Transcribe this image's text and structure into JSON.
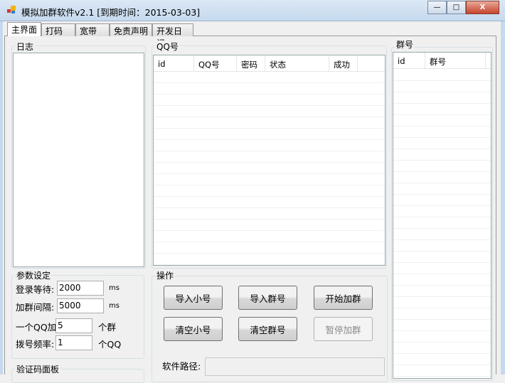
{
  "window": {
    "title": "模拟加群软件v2.1 [到期时间：2015-03-03]",
    "minimize": "—",
    "maximize": "□",
    "close": "X"
  },
  "tabs": [
    "主界面",
    "打码",
    "宽带",
    "免责声明",
    "开发日记"
  ],
  "log": {
    "label": "日志"
  },
  "qq": {
    "label": "QQ号",
    "columns": [
      "id",
      "QQ号",
      "密码",
      "状态",
      "成功"
    ]
  },
  "groups": {
    "label": "群号",
    "columns": [
      "id",
      "群号"
    ]
  },
  "params": {
    "label": "参数设定",
    "login_wait": {
      "label": "登录等待:",
      "value": "2000",
      "unit": "ms"
    },
    "join_interval": {
      "label": "加群间隔:",
      "value": "5000",
      "unit": "ms"
    },
    "per_qq": {
      "label": "一个QQ加:",
      "value": "5",
      "unit": "个群"
    },
    "dial_freq": {
      "label": "拨号频率:",
      "value": "1",
      "unit": "个QQ"
    }
  },
  "captcha": {
    "label": "验证码面板"
  },
  "ops": {
    "label": "操作",
    "import_qq": "导入小号",
    "import_group": "导入群号",
    "start": "开始加群",
    "clear_qq": "清空小号",
    "clear_group": "清空群号",
    "pause": "暂停加群",
    "path_label": "软件路径:",
    "path_value": ""
  }
}
